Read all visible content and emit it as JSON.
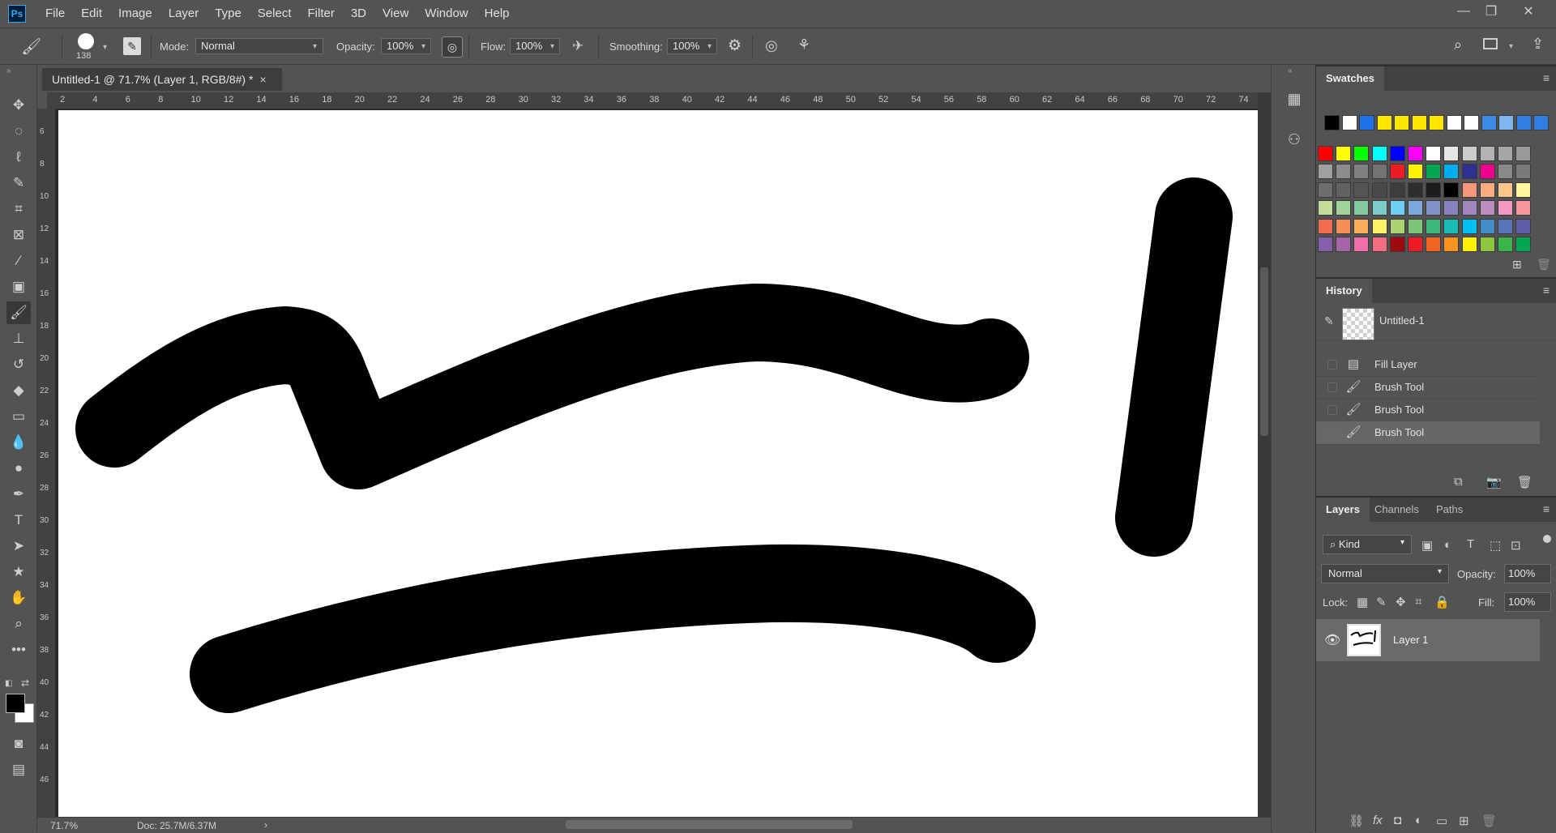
{
  "app": {
    "logo": "Ps"
  },
  "menu": [
    "File",
    "Edit",
    "Image",
    "Layer",
    "Type",
    "Select",
    "Filter",
    "3D",
    "View",
    "Window",
    "Help"
  ],
  "options": {
    "brush_size": "138",
    "mode_label": "Mode:",
    "mode_value": "Normal",
    "opacity_label": "Opacity:",
    "opacity_value": "100%",
    "flow_label": "Flow:",
    "flow_value": "100%",
    "smoothing_label": "Smoothing:",
    "smoothing_value": "100%"
  },
  "document": {
    "tab_title": "Untitled-1 @ 71.7% (Layer 1, RGB/8#) *",
    "close": "×"
  },
  "ruler_top": [
    "2",
    "4",
    "6",
    "8",
    "10",
    "12",
    "14",
    "16",
    "18",
    "20",
    "22",
    "24",
    "26",
    "28",
    "30",
    "32",
    "34",
    "36",
    "38",
    "40",
    "42",
    "44",
    "46",
    "48",
    "50",
    "52",
    "54",
    "56",
    "58",
    "60",
    "62",
    "64",
    "66",
    "68",
    "70",
    "72",
    "74"
  ],
  "ruler_left": [
    "6",
    "8",
    "10",
    "12",
    "14",
    "16",
    "18",
    "20",
    "22",
    "24",
    "26",
    "28",
    "30",
    "32",
    "34",
    "36",
    "38",
    "40",
    "42",
    "44",
    "46"
  ],
  "status": {
    "zoom": "71.7%",
    "doc": "Doc: 25.7M/6.37M",
    "arrow": "›"
  },
  "swatches": {
    "tab": "Swatches",
    "recent": [
      "#000000",
      "#ffffff",
      "#1e73e8",
      "#ffe600",
      "#ffe600",
      "#ffe600",
      "#ffe600",
      "#ffffff",
      "#ffffff",
      "#3d8be8",
      "#7fb6f0",
      "#2f7de0",
      "#2f7de0"
    ],
    "grid": [
      [
        "#ff0000",
        "#ffff00",
        "#00ff00",
        "#00ffff",
        "#0000ff",
        "#ff00ff",
        "#ffffff",
        "#e6e6e6",
        "#cccccc",
        "#b3b3b3",
        "#a6a6a6",
        "#999999"
      ],
      [
        "#a0a0a0",
        "#8c8c8c",
        "#808080",
        "#737373",
        "#ed1c24",
        "#fff200",
        "#00a651",
        "#00aeef",
        "#2e3192",
        "#ec008c",
        "#898989",
        "#7a7a7a"
      ],
      [
        "#6e6e6e",
        "#626262",
        "#555555",
        "#4a4a4a",
        "#3d3d3d",
        "#2e2e2e",
        "#1c1c1c",
        "#000000",
        "#f7977a",
        "#f9ad81",
        "#fdc68a",
        "#fff79a"
      ],
      [
        "#c4df9b",
        "#a3d39c",
        "#82ca9d",
        "#7accc8",
        "#6dcff6",
        "#7da7d9",
        "#8393ca",
        "#8781bd",
        "#a187be",
        "#bc8dbf",
        "#f49ac2",
        "#f6989d"
      ],
      [
        "#f26c4f",
        "#f68e55",
        "#fbaf5c",
        "#fff467",
        "#acd372",
        "#7cc576",
        "#3bb878",
        "#1abbb4",
        "#00bff3",
        "#438cca",
        "#5574b9",
        "#605ca8"
      ],
      [
        "#855fa8",
        "#a763a8",
        "#f06ea9",
        "#f26d7d",
        "#9e0b0f",
        "#ed1c24",
        "#f26522",
        "#f7941d",
        "#fff200",
        "#8dc63f",
        "#39b54a",
        "#00a651"
      ]
    ]
  },
  "history": {
    "tab": "History",
    "snapshot": "Untitled-1",
    "items": [
      "Fill Layer",
      "Brush Tool",
      "Brush Tool",
      "Brush Tool"
    ]
  },
  "layers": {
    "tabs": [
      "Layers",
      "Channels",
      "Paths"
    ],
    "kind": "Kind",
    "blend": "Normal",
    "opacity_label": "Opacity:",
    "opacity_value": "100%",
    "lock_label": "Lock:",
    "fill_label": "Fill:",
    "fill_value": "100%",
    "layer_name": "Layer 1"
  },
  "colors": {
    "foreground": "#000000",
    "background": "#ffffff"
  }
}
